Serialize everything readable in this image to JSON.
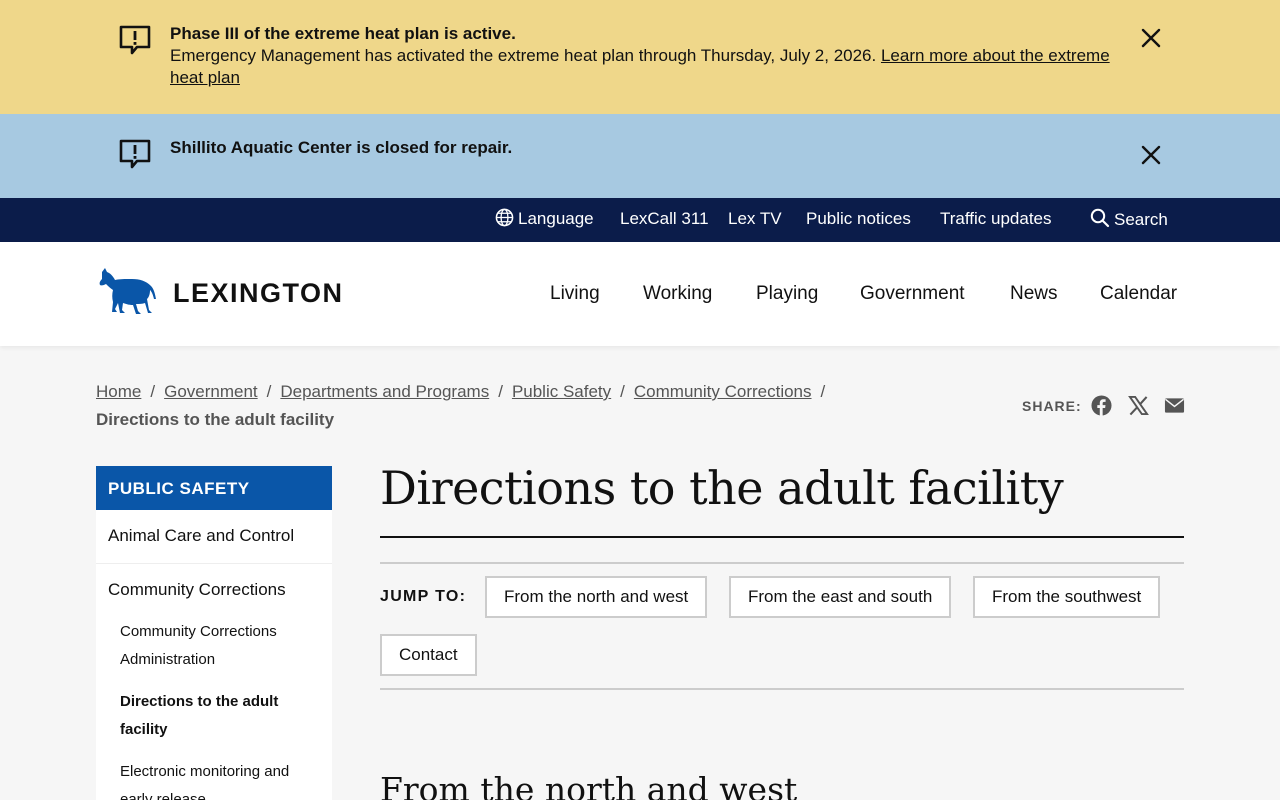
{
  "alerts": [
    {
      "title": "Phase III of the extreme heat plan is active.",
      "body": "Emergency Management has activated the extreme heat plan through Thursday, July 2, 2026.",
      "link": "Learn more about the extreme heat plan"
    },
    {
      "title": "Shillito Aquatic Center is closed for repair."
    }
  ],
  "utility": {
    "language": "Language",
    "lexcall": "LexCall 311",
    "lextv": "Lex TV",
    "notices": "Public notices",
    "traffic": "Traffic updates",
    "search": "Search"
  },
  "brand": {
    "name": "LEXINGTON",
    "horse_color": "#0a56a8"
  },
  "nav": [
    "Living",
    "Working",
    "Playing",
    "Government",
    "News",
    "Calendar"
  ],
  "breadcrumb": {
    "items": [
      "Home",
      "Government",
      "Departments and Programs",
      "Public Safety",
      "Community Corrections"
    ],
    "separator": "/",
    "current": "Directions to the adult facility"
  },
  "share": {
    "label": "SHARE:",
    "icons": [
      "facebook-icon",
      "x-icon",
      "email-icon"
    ]
  },
  "sidenav": {
    "heading": "PUBLIC SAFETY",
    "items": [
      {
        "label": "Animal Care and Control"
      },
      {
        "label": "Community Corrections"
      },
      {
        "label": "Community Corrections Administration"
      },
      {
        "label": "Directions to the adult facility",
        "active": true
      },
      {
        "label": "Electronic monitoring and early release"
      }
    ]
  },
  "page": {
    "title": "Directions to the adult facility",
    "jump_label": "JUMP TO:",
    "jump_links": [
      "From the north and west",
      "From the east and south",
      "From the southwest",
      "Contact"
    ],
    "section_heading": "From the north and west"
  },
  "colors": {
    "alert_yellow": "#efd78a",
    "alert_blue": "#a7c9e1",
    "utility_bg": "#0b1c4a",
    "brand_blue": "#0a56a8"
  }
}
